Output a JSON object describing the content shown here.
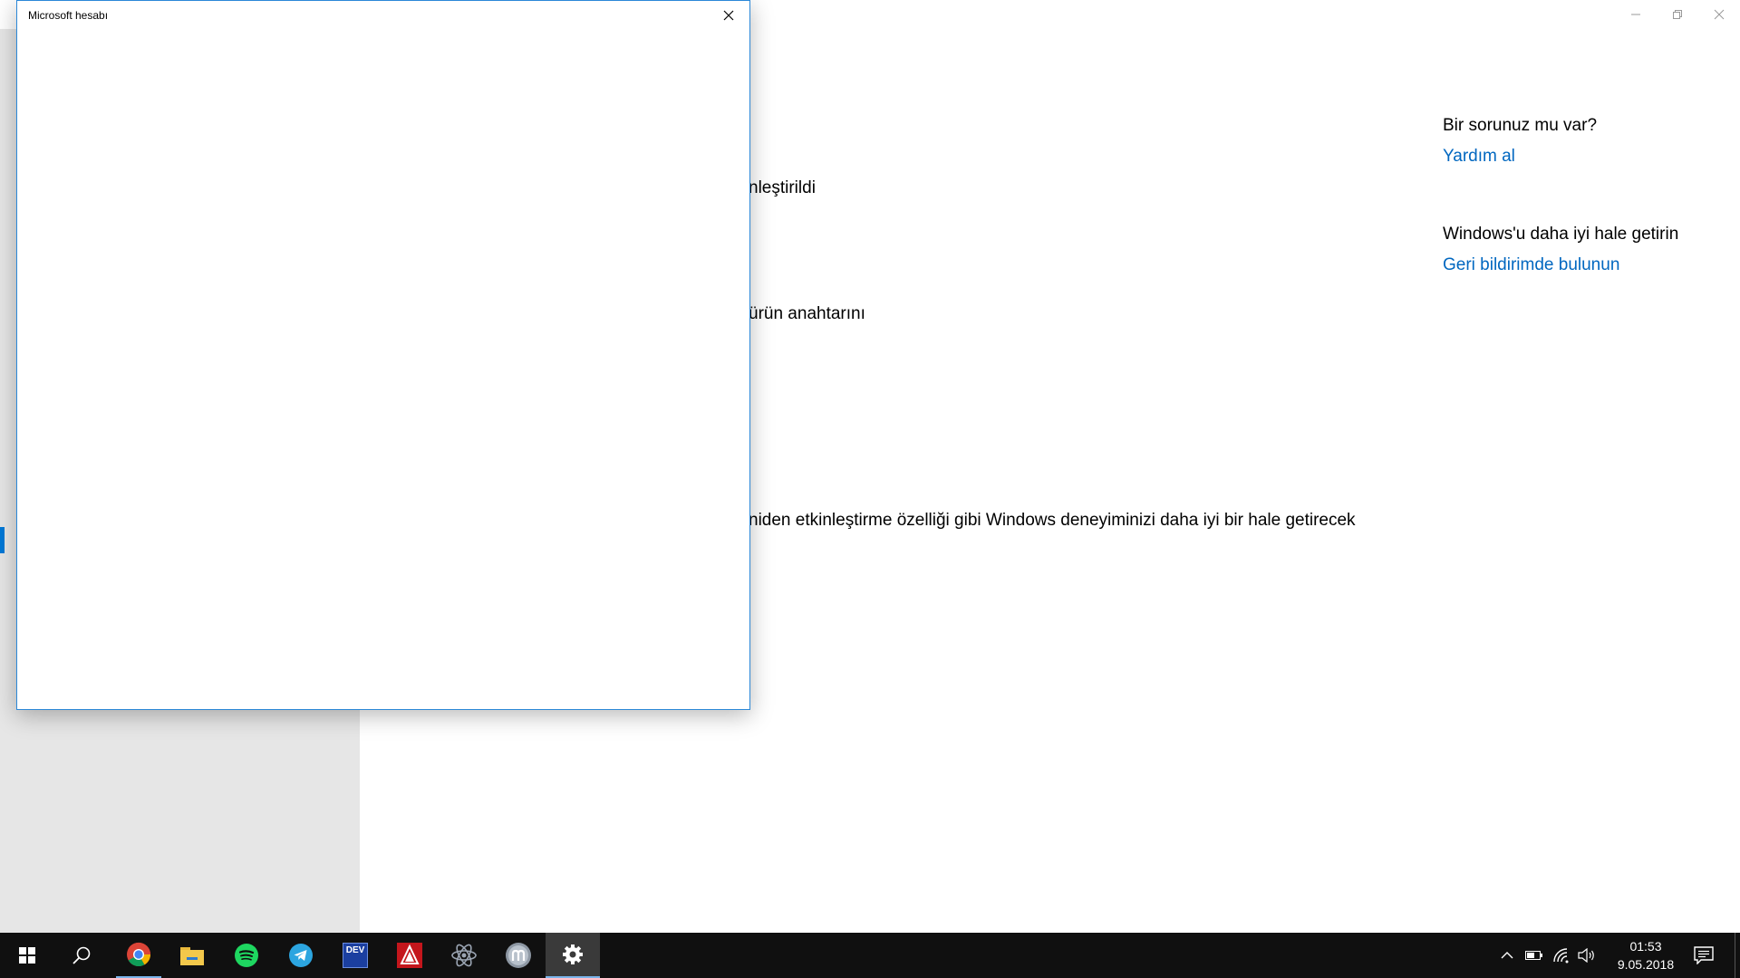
{
  "dialog": {
    "title": "Microsoft hesabı"
  },
  "main": {
    "line1": "nleştirildi",
    "line2": "ürün anahtarını",
    "line3": "niden etkinleştirme özelliği gibi Windows deneyiminizi daha iyi bir hale getirecek"
  },
  "side": {
    "help_heading": "Bir sorunuz mu var?",
    "help_link": "Yardım al",
    "improve_heading": "Windows'u daha iyi hale getirin",
    "feedback_link": "Geri bildirimde bulunun"
  },
  "taskbar": {
    "apps": [
      {
        "icon": "windows-start-icon"
      },
      {
        "icon": "search-icon"
      },
      {
        "icon": "chrome-icon"
      },
      {
        "icon": "file-explorer-icon"
      },
      {
        "icon": "spotify-icon"
      },
      {
        "icon": "telegram-icon"
      },
      {
        "icon": "dev-cpp-icon"
      },
      {
        "icon": "autocad-icon"
      },
      {
        "icon": "atom-icon"
      },
      {
        "icon": "moodle-icon"
      },
      {
        "icon": "settings-gear-icon"
      }
    ],
    "dev_label": "DEV",
    "clock_time": "01:53",
    "clock_date": "9.05.2018"
  },
  "colors": {
    "accent": "#0078d7",
    "link": "#0067c0",
    "taskbar": "#101010",
    "sidebar": "#e6e6e6"
  }
}
